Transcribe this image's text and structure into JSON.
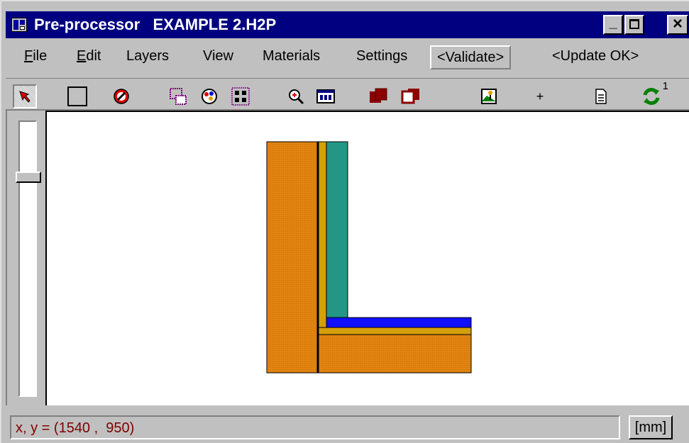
{
  "window": {
    "title": "Pre-processor   EXAMPLE 2.H2P",
    "controls": {
      "minimize": "_",
      "maximize": "□",
      "close": "×"
    }
  },
  "menu": {
    "items": [
      {
        "label": "File",
        "accel": "F",
        "rest": "ile"
      },
      {
        "label": "Edit",
        "accel": "E",
        "rest": "dit"
      },
      {
        "label": "Layers"
      },
      {
        "label": "View"
      },
      {
        "label": "Materials"
      },
      {
        "label": "Settings"
      }
    ],
    "validate": "<Validate>",
    "update": "<Update OK>"
  },
  "toolbar": {
    "tools": [
      "select-arrow-icon",
      "rectangle-icon",
      "no-entry-icon",
      "layer-rect-icon",
      "palette-icon",
      "grid-dots-icon",
      "zoom-icon",
      "screen-icon",
      "solid-square-icon",
      "outline-square-icon",
      "person-icon",
      "plus-icon",
      "document-icon",
      "refresh-icon"
    ],
    "plus": "+",
    "refresh_badge": "1"
  },
  "drawing": {
    "materials": {
      "wall": "#e08310",
      "thin_layer": "#d4a00a",
      "insulation": "#239685",
      "membrane": "#1010ff"
    }
  },
  "status": {
    "coords": "x, y = (1540 ,  950)",
    "unit": "[mm]"
  },
  "slider": {
    "level": 0.19
  }
}
